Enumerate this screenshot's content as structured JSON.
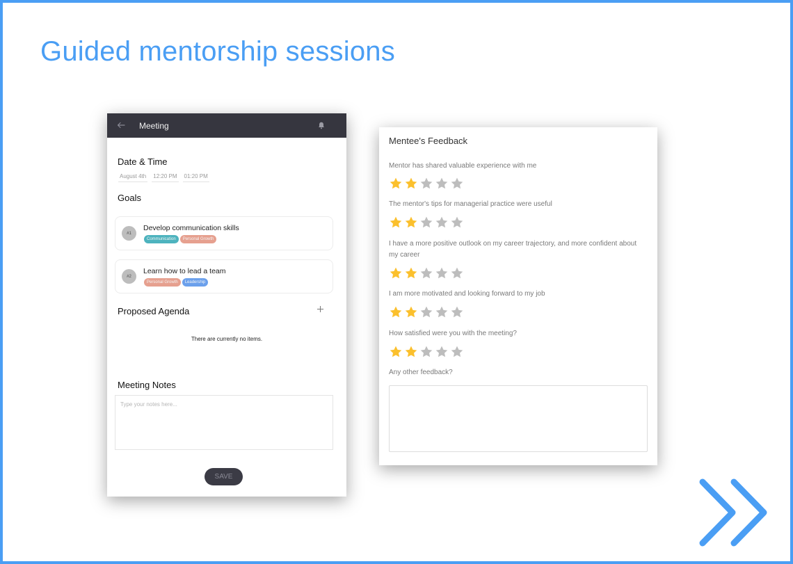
{
  "page": {
    "title": "Guided mentorship sessions",
    "accent_color": "#4a9ef4"
  },
  "meeting": {
    "header": {
      "back_icon": "arrow-left-icon",
      "title": "Meeting",
      "bell_icon": "bell-icon"
    },
    "date_time": {
      "title": "Date & Time",
      "date": "August 4th",
      "start_time": "12:20 PM",
      "end_time": "01:20 PM"
    },
    "goals": {
      "title": "Goals",
      "items": [
        {
          "number": "#1",
          "text": "Develop communication skills",
          "tags": [
            {
              "label": "Communication",
              "color": "#4db3be"
            },
            {
              "label": "Personal Growth",
              "color": "#e6a08f"
            }
          ]
        },
        {
          "number": "#2",
          "text": "Learn how to lead a team",
          "tags": [
            {
              "label": "Personal Growth",
              "color": "#e6a08f"
            },
            {
              "label": "Leadership",
              "color": "#6ba0ec"
            }
          ]
        }
      ]
    },
    "agenda": {
      "title": "Proposed Agenda",
      "add_icon": "plus-icon",
      "empty_text": "There are currently no items."
    },
    "notes": {
      "title": "Meeting Notes",
      "placeholder": "Type your notes here...",
      "value": ""
    },
    "save_label": "SAVE"
  },
  "feedback": {
    "title": "Mentee's Feedback",
    "max_rating": 5,
    "star_filled_color": "#fbc02d",
    "star_empty_color": "#bdbdbd",
    "questions": [
      {
        "text": "Mentor has shared valuable experience with me",
        "rating": 2
      },
      {
        "text": "The mentor's tips for managerial practice were useful",
        "rating": 2
      },
      {
        "text": "I have a more positive outlook on my career trajectory, and more confident about my career",
        "rating": 2
      },
      {
        "text": "I am more motivated and looking forward to my job",
        "rating": 2
      },
      {
        "text": "How satisfied were you with the meeting?",
        "rating": 2
      }
    ],
    "other_feedback": {
      "label": "Any other feedback?",
      "value": ""
    }
  },
  "navigation": {
    "next_icon": "double-chevron-right-icon"
  }
}
